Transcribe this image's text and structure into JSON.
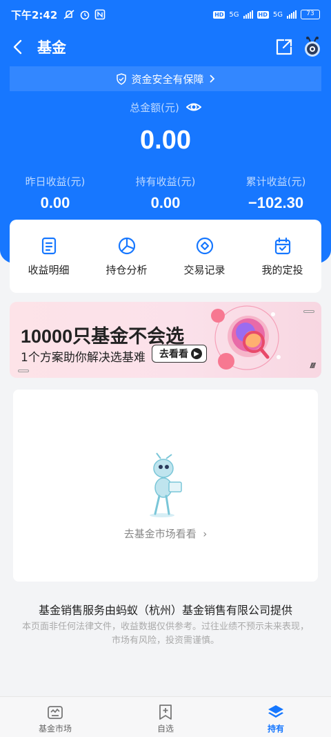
{
  "status_bar": {
    "time": "下午2:42",
    "network_1": "5G",
    "network_2": "5G",
    "hd_1": "HD",
    "hd_2": "HD",
    "battery": "73"
  },
  "nav": {
    "title": "基金"
  },
  "safety": {
    "text": "资金安全有保障"
  },
  "summary": {
    "total_label": "总金额(元)",
    "total_value": "0.00",
    "stats": [
      {
        "label": "昨日收益(元)",
        "value": "0.00"
      },
      {
        "label": "持有收益(元)",
        "value": "0.00"
      },
      {
        "label": "累计收益(元)",
        "value": "−102.30"
      }
    ]
  },
  "actions": [
    {
      "label": "收益明细",
      "icon": "document-icon"
    },
    {
      "label": "持仓分析",
      "icon": "pie-chart-icon"
    },
    {
      "label": "交易记录",
      "icon": "exchange-icon"
    },
    {
      "label": "我的定投",
      "icon": "calendar-icon"
    }
  ],
  "banner": {
    "title": "10000只基金不会选",
    "subtitle": "1个方案助你解决选基难",
    "button_label": "去看看"
  },
  "empty_state": {
    "link_text": "去基金市场看看"
  },
  "footer": {
    "provider": "基金销售服务由蚂蚁（杭州）基金销售有限公司提供",
    "disclaimer_line1": "本页面非任何法律文件，收益数据仅供参考。过往业绩不预示未来表现，",
    "disclaimer_line2": "市场有风险，投资需谨慎。"
  },
  "tabs": [
    {
      "label": "基金市场",
      "active": false
    },
    {
      "label": "自选",
      "active": false
    },
    {
      "label": "持有",
      "active": true
    }
  ],
  "colors": {
    "brand_blue": "#1777ff",
    "active_tab": "#1677ff"
  }
}
